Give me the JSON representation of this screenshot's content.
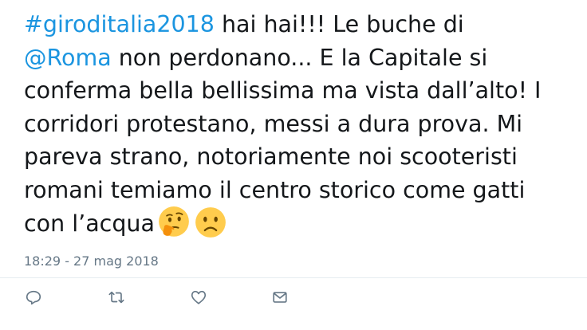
{
  "tweet": {
    "lines": [
      {
        "hashtag": "#giroditalia2018",
        "text": " hai hai!!! Le buche di"
      },
      {
        "mention": "@Roma",
        "text": " non perdonano... E la Capitale si"
      },
      {
        "text": "conferma bella bellissima ma vista dall’alto! I"
      },
      {
        "text": "corridori protestano, messi a dura prova. Mi"
      },
      {
        "text": "pareva strano, notoriamente noi scooteristi"
      },
      {
        "text": "romani temiamo il centro storico come gatti"
      },
      {
        "text": "con l’acqua"
      }
    ],
    "emojis": [
      "thinking-face-emoji",
      "frowning-face-emoji"
    ],
    "timestamp": "18:29 - 27 mag 2018"
  },
  "actions": [
    {
      "name": "reply-button",
      "icon": "reply-icon"
    },
    {
      "name": "retweet-button",
      "icon": "retweet-icon"
    },
    {
      "name": "like-button",
      "icon": "heart-icon"
    },
    {
      "name": "direct-message-button",
      "icon": "envelope-icon"
    }
  ],
  "colors": {
    "text": "#14171a",
    "link": "#1b95e0",
    "muted": "#657786",
    "divider": "#e6ecf0",
    "emoji_face": "#ffcc4d",
    "emoji_feature": "#664500"
  }
}
